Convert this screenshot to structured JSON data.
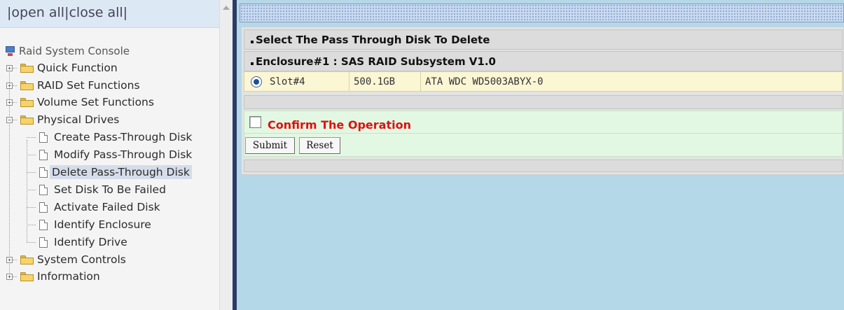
{
  "nav": {
    "open_all": "open all",
    "close_all": "close all"
  },
  "tree": {
    "root": "Raid System Console",
    "items": [
      {
        "label": "Quick Function",
        "type": "folder",
        "state": "collapsed"
      },
      {
        "label": "RAID Set Functions",
        "type": "folder",
        "state": "collapsed"
      },
      {
        "label": "Volume Set Functions",
        "type": "folder",
        "state": "collapsed"
      },
      {
        "label": "Physical Drives",
        "type": "folder",
        "state": "expanded"
      },
      {
        "label": "Create Pass-Through Disk",
        "type": "page"
      },
      {
        "label": "Modify Pass-Through Disk",
        "type": "page"
      },
      {
        "label": "Delete Pass-Through Disk",
        "type": "page",
        "selected": true
      },
      {
        "label": "Set Disk To Be Failed",
        "type": "page"
      },
      {
        "label": "Activate Failed Disk",
        "type": "page"
      },
      {
        "label": "Identify Enclosure",
        "type": "page"
      },
      {
        "label": "Identify Drive",
        "type": "page"
      },
      {
        "label": "System Controls",
        "type": "folder",
        "state": "collapsed"
      },
      {
        "label": "Information",
        "type": "folder",
        "state": "collapsed"
      }
    ]
  },
  "main": {
    "section_title": "Select The Pass Through Disk To Delete",
    "enclosure_title": "Enclosure#1 : SAS RAID Subsystem V1.0",
    "disk_row": {
      "selected": true,
      "slot": "Slot#4",
      "capacity": "500.1GB",
      "model": "ATA WDC WD5003ABYX-0"
    },
    "confirm": {
      "checked": false,
      "label": "Confirm The Operation"
    },
    "buttons": {
      "submit": "Submit",
      "reset": "Reset"
    }
  },
  "colors": {
    "confirm_text": "#dd1111",
    "right_background": "#b4d8e8",
    "frame_divider": "#2c3a66",
    "disk_row_background": "#fbf6d4",
    "confirm_background": "#e3f8e3"
  }
}
